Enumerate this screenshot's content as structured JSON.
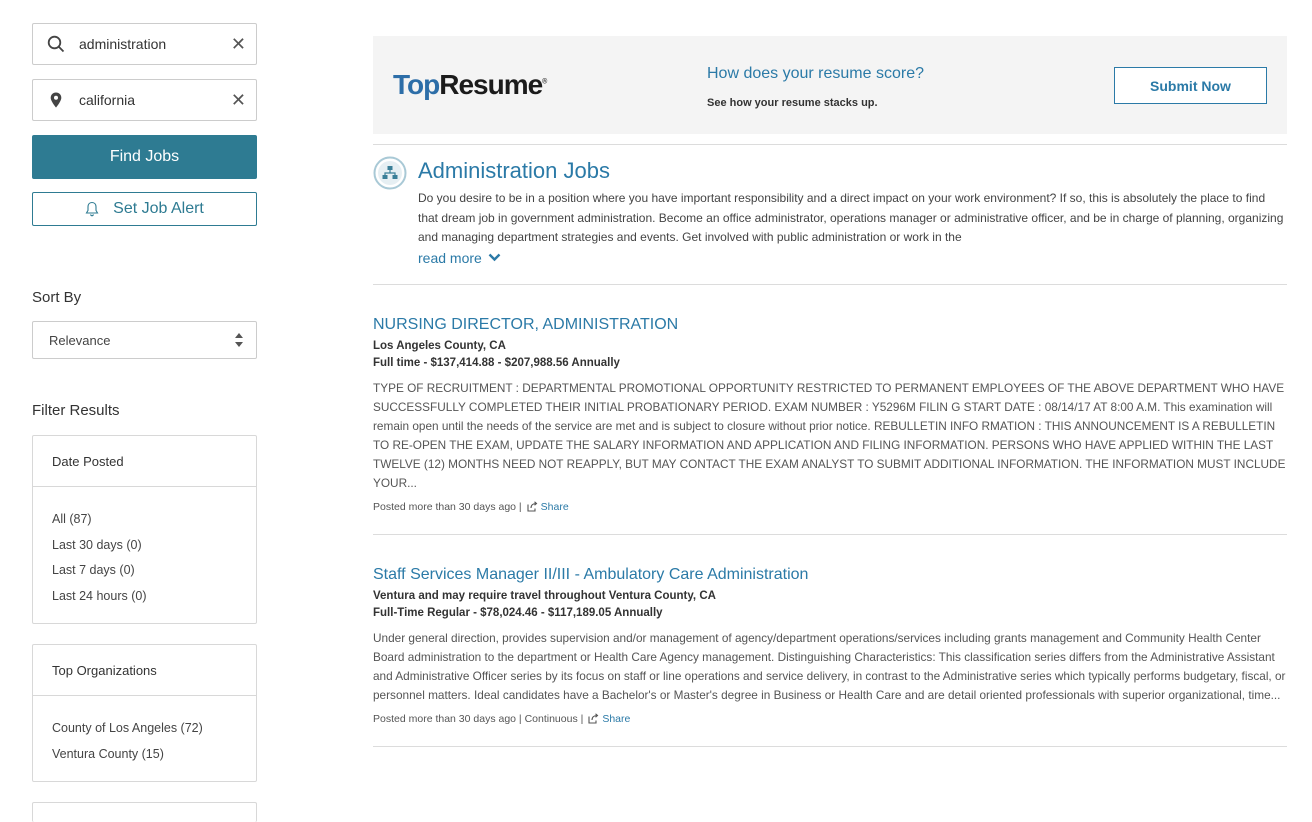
{
  "search": {
    "keyword_value": "administration",
    "location_value": "california",
    "find_label": "Find Jobs",
    "alert_label": "Set Job Alert"
  },
  "sort": {
    "label": "Sort By",
    "selected": "Relevance"
  },
  "filters": {
    "label": "Filter Results",
    "date_posted": {
      "title": "Date Posted",
      "options": [
        "All (87)",
        "Last 30 days (0)",
        "Last 7 days (0)",
        "Last 24 hours (0)"
      ]
    },
    "top_orgs": {
      "title": "Top Organizations",
      "options": [
        "County of Los Angeles (72)",
        "Ventura County (15)"
      ]
    }
  },
  "ad": {
    "logo_part1": "Top",
    "logo_part2": "Resume",
    "logo_mark": "®",
    "question": "How does your resume score?",
    "subtext": "See how your resume stacks up.",
    "button": "Submit Now"
  },
  "category": {
    "title": "Administration Jobs",
    "description": "Do you desire to be in a position where you have important responsibility and a direct impact on your work environment? If so, this is absolutely the place to find that dream job in government administration. Become an office administrator, operations manager or administrative officer, and be in charge of planning, organizing and managing department strategies and events. Get involved with public administration or work in the",
    "read_more": "read more"
  },
  "jobs": [
    {
      "title": "NURSING DIRECTOR, ADMINISTRATION",
      "location": "Los Angeles County, CA",
      "pay": "Full time - $137,414.88 - $207,988.56 Annually",
      "description": "TYPE OF RECRUITMENT : DEPARTMENTAL PROMOTIONAL OPPORTUNITY RESTRICTED TO PERMANENT EMPLOYEES OF THE ABOVE DEPARTMENT WHO HAVE SUCCESSFULLY COMPLETED THEIR INITIAL PROBATIONARY PERIOD. EXAM NUMBER : Y5296M FILIN G START DATE : 08/14/17 AT 8:00 A.M. This examination will remain open until the needs of the service are met and is subject to closure without prior notice. REBULLETIN INFO RMATION : THIS ANNOUNCEMENT IS A REBULLETIN TO RE-OPEN THE EXAM, UPDATE THE SALARY INFORMATION AND APPLICATION AND FILING INFORMATION. PERSONS WHO HAVE APPLIED WITHIN THE LAST TWELVE (12) MONTHS NEED NOT REAPPLY, BUT MAY CONTACT THE EXAM ANALYST TO SUBMIT ADDITIONAL INFORMATION. THE INFORMATION MUST INCLUDE YOUR...",
      "meta": "Posted more than 30 days ago |",
      "share": "Share"
    },
    {
      "title": "Staff Services Manager II/III - Ambulatory Care Administration",
      "location": "Ventura and may require travel throughout Ventura County, CA",
      "pay": "Full-Time Regular - $78,024.46 - $117,189.05 Annually",
      "description": "Under general direction, provides supervision and/or management of agency/department operations/services including grants management and Community Health Center Board administration to the department or Health Care Agency management. Distinguishing Characteristics: This classification series differs from the Administrative Assistant and Administrative Officer series by its focus on staff or line operations and service delivery, in contrast to the Administrative series which typically performs budgetary, fiscal, or personnel matters. Ideal candidates have a Bachelor's or Master's degree in Business or Health Care and are detail oriented professionals with superior organizational, time...",
      "meta": "Posted more than 30 days ago | Continuous |",
      "share": "Share"
    }
  ]
}
